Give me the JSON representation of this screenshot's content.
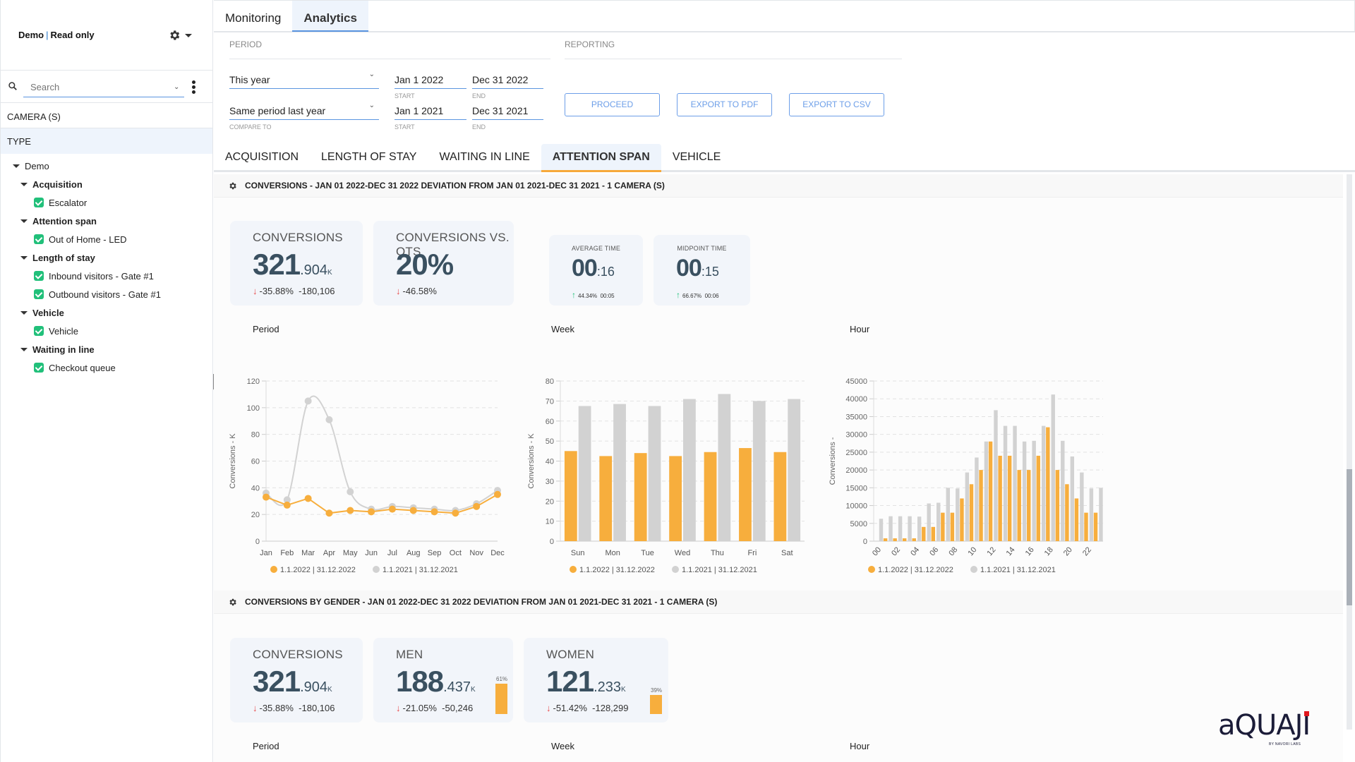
{
  "sidebar": {
    "title_left": "Demo",
    "title_sep": "|",
    "title_right": "Read only",
    "search_placeholder": "Search",
    "camera_label": "CAMERA (S)",
    "type_label": "TYPE",
    "tree": [
      {
        "label": "Demo",
        "level": 0
      },
      {
        "label": "Acquisition",
        "level": 1
      },
      {
        "label": "Escalator",
        "level": 2,
        "checked": true
      },
      {
        "label": "Attention span",
        "level": 1
      },
      {
        "label": "Out of Home - LED",
        "level": 2,
        "checked": true
      },
      {
        "label": "Length of stay",
        "level": 1
      },
      {
        "label": "Inbound visitors - Gate #1",
        "level": 2,
        "checked": true
      },
      {
        "label": "Outbound visitors - Gate #1",
        "level": 2,
        "checked": true
      },
      {
        "label": "Vehicle",
        "level": 1
      },
      {
        "label": "Vehicle",
        "level": 2,
        "checked": true
      },
      {
        "label": "Waiting in line",
        "level": 1
      },
      {
        "label": "Checkout queue",
        "level": 2,
        "checked": true
      }
    ]
  },
  "top_tabs": [
    {
      "label": "Monitoring",
      "active": false
    },
    {
      "label": "Analytics",
      "active": true
    }
  ],
  "period": {
    "label": "PERIOD",
    "period_select": "This year",
    "start_1": "Jan 1 2022",
    "end_1": "Dec 31 2022",
    "compare_select": "Same period last year",
    "compare_label": "COMPARE TO",
    "start_2": "Jan 1 2021",
    "end_2": "Dec 31 2021",
    "start_label": "START",
    "end_label": "END"
  },
  "reporting": {
    "label": "REPORTING",
    "proceed": "PROCEED",
    "export_pdf": "EXPORT TO PDF",
    "export_csv": "EXPORT TO CSV"
  },
  "sub_tabs": [
    {
      "label": "ACQUISITION",
      "active": false
    },
    {
      "label": "LENGTH OF STAY",
      "active": false
    },
    {
      "label": "WAITING IN LINE",
      "active": false
    },
    {
      "label": "ATTENTION SPAN",
      "active": true
    },
    {
      "label": "VEHICLE",
      "active": false
    }
  ],
  "section1": {
    "title": "CONVERSIONS - JAN 01 2022-DEC 31 2022 DEVIATION FROM JAN 01 2021-DEC 31 2021 - 1 CAMERA (S)",
    "cards": {
      "conversions": {
        "title": "CONVERSIONS",
        "int": "321",
        "dec": ".904",
        "unit": "K",
        "pct": "-35.88%",
        "abs": "-180,106"
      },
      "vs_ots": {
        "title": "CONVERSIONS VS. OTS",
        "value": "20%",
        "pct": "-46.58%"
      },
      "avg_time": {
        "title": "AVERAGE TIME",
        "int": "00",
        "dec": ":16",
        "pct": "44.34%",
        "abs": "00:05"
      },
      "mid_time": {
        "title": "MIDPOINT TIME",
        "int": "00",
        "dec": ":15",
        "pct": "66.67%",
        "abs": "00:06"
      }
    }
  },
  "section2": {
    "title": "CONVERSIONS BY GENDER - JAN 01 2022-DEC 31 2022 DEVIATION FROM JAN 01 2021-DEC 31 2021 - 1 CAMERA (S)",
    "cards": {
      "conversions": {
        "title": "CONVERSIONS",
        "int": "321",
        "dec": ".904",
        "unit": "K",
        "pct": "-35.88%",
        "abs": "-180,106"
      },
      "men": {
        "title": "MEN",
        "int": "188",
        "dec": ".437",
        "unit": "K",
        "pct": "-21.05%",
        "abs": "-50,246",
        "share_label": "61%",
        "share": 0.61
      },
      "women": {
        "title": "WOMEN",
        "int": "121",
        "dec": ".233",
        "unit": "K",
        "pct": "-51.42%",
        "abs": "-128,299",
        "share_label": "39%",
        "share": 0.39
      }
    },
    "chart_titles": [
      "Period",
      "Week",
      "Hour"
    ]
  },
  "colors": {
    "current": "#f7ae3d",
    "previous": "#d2d2d2",
    "accent": "#5a95e0",
    "down": "#e84a4a",
    "up": "#21c07a"
  },
  "chart_data": [
    {
      "type": "line",
      "title": "Period",
      "xlabel": "",
      "ylabel": "Conversions - K",
      "categories": [
        "Jan",
        "Feb",
        "Mar",
        "Apr",
        "May",
        "Jun",
        "Jul",
        "Aug",
        "Sep",
        "Oct",
        "Nov",
        "Dec"
      ],
      "ylim": [
        0,
        120
      ],
      "yticks": [
        0,
        20,
        40,
        60,
        80,
        100,
        120
      ],
      "grid": true,
      "legend": "bottom",
      "series": [
        {
          "name": "1.1.2022 | 31.12.2022",
          "values": [
            33,
            27,
            32,
            21,
            23,
            22,
            24,
            23,
            22,
            21,
            26,
            35
          ]
        },
        {
          "name": "1.1.2021 | 31.12.2021",
          "values": [
            36,
            31,
            105,
            91,
            37,
            24,
            26,
            25,
            24,
            23,
            28,
            38
          ]
        }
      ]
    },
    {
      "type": "bar",
      "title": "Week",
      "xlabel": "",
      "ylabel": "Conversions - K",
      "categories": [
        "Sun",
        "Mon",
        "Tue",
        "Wed",
        "Thu",
        "Fri",
        "Sat"
      ],
      "ylim": [
        0,
        80
      ],
      "yticks": [
        0,
        10,
        20,
        30,
        40,
        50,
        60,
        70,
        80
      ],
      "grid": true,
      "legend": "bottom",
      "series": [
        {
          "name": "1.1.2022 | 31.12.2022",
          "values": [
            45,
            42.5,
            44,
            42.5,
            44.5,
            46.5,
            44.5
          ]
        },
        {
          "name": "1.1.2021 | 31.12.2021",
          "values": [
            67.5,
            68.5,
            67.5,
            71,
            73.5,
            70,
            71
          ]
        }
      ]
    },
    {
      "type": "bar",
      "title": "Hour",
      "xlabel": "",
      "ylabel": "Conversions -",
      "categories": [
        "00",
        "01",
        "02",
        "03",
        "04",
        "05",
        "06",
        "07",
        "08",
        "09",
        "10",
        "11",
        "12",
        "13",
        "14",
        "15",
        "16",
        "17",
        "18",
        "19",
        "20",
        "21",
        "22",
        "23"
      ],
      "tick_labels": [
        "00",
        "02",
        "04",
        "06",
        "08",
        "10",
        "12",
        "14",
        "16",
        "18",
        "20",
        "22"
      ],
      "ylim": [
        0,
        45000
      ],
      "yticks": [
        0,
        5000,
        10000,
        15000,
        20000,
        25000,
        30000,
        35000,
        40000,
        45000
      ],
      "grid": true,
      "legend": "bottom",
      "series": [
        {
          "name": "1.1.2022 | 31.12.2022",
          "values": [
            0,
            800,
            800,
            800,
            800,
            4000,
            4000,
            8000,
            8000,
            12000,
            16000,
            20000,
            28000,
            24000,
            24000,
            20000,
            20000,
            24000,
            32000,
            20000,
            16000,
            12000,
            8000,
            8000
          ]
        },
        {
          "name": "1.1.2021 | 31.12.2021",
          "values": [
            6300,
            7000,
            7000,
            7000,
            6900,
            10600,
            10800,
            15000,
            14800,
            19300,
            23500,
            28000,
            36800,
            32400,
            32400,
            28000,
            28200,
            32400,
            41200,
            28200,
            23800,
            19300,
            14800,
            15000
          ]
        }
      ]
    }
  ],
  "logo": {
    "word": "aQUAJI",
    "byline": "BY NAVORI LABS"
  }
}
